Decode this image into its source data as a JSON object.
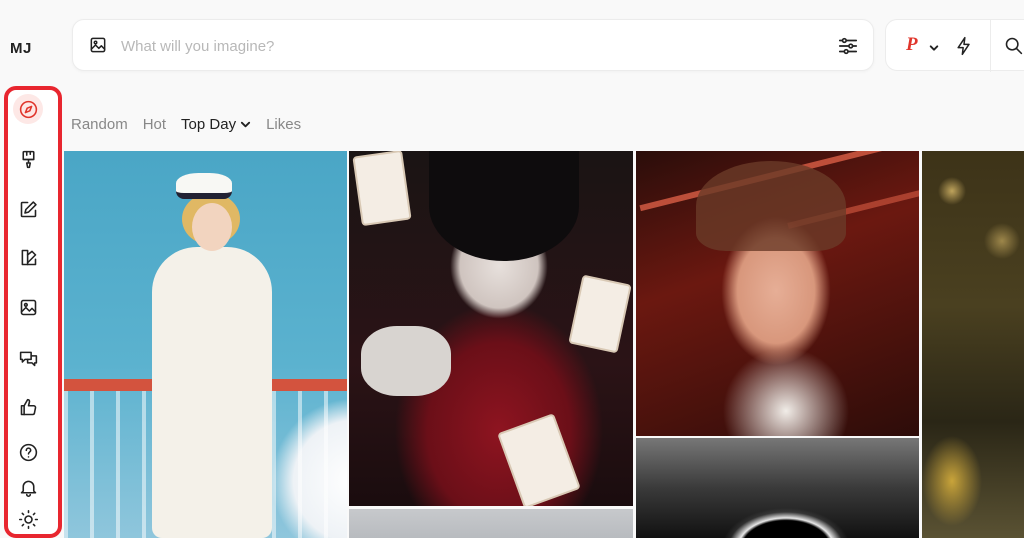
{
  "app": {
    "logo": "MJ"
  },
  "search": {
    "placeholder": "What will you imagine?"
  },
  "header": {
    "profile_letter": "P"
  },
  "tabs": [
    {
      "label": "Random"
    },
    {
      "label": "Hot"
    },
    {
      "label": "Top Day"
    },
    {
      "label": "Likes"
    }
  ],
  "sidebar": {
    "items": [
      {
        "icon": "compass-icon",
        "name": "explore"
      },
      {
        "icon": "paintbrush-icon",
        "name": "create"
      },
      {
        "icon": "pencil-icon",
        "name": "edit"
      },
      {
        "icon": "organize-icon",
        "name": "organize"
      },
      {
        "icon": "image-icon",
        "name": "gallery"
      },
      {
        "icon": "chat-icon",
        "name": "chat"
      },
      {
        "icon": "thumbs-up-icon",
        "name": "likes"
      },
      {
        "icon": "help-icon",
        "name": "help"
      },
      {
        "icon": "bell-icon",
        "name": "notifications"
      },
      {
        "icon": "sun-icon",
        "name": "theme"
      }
    ]
  },
  "colors": {
    "accent": "#e0352b",
    "highlight_border": "#e8262f"
  }
}
